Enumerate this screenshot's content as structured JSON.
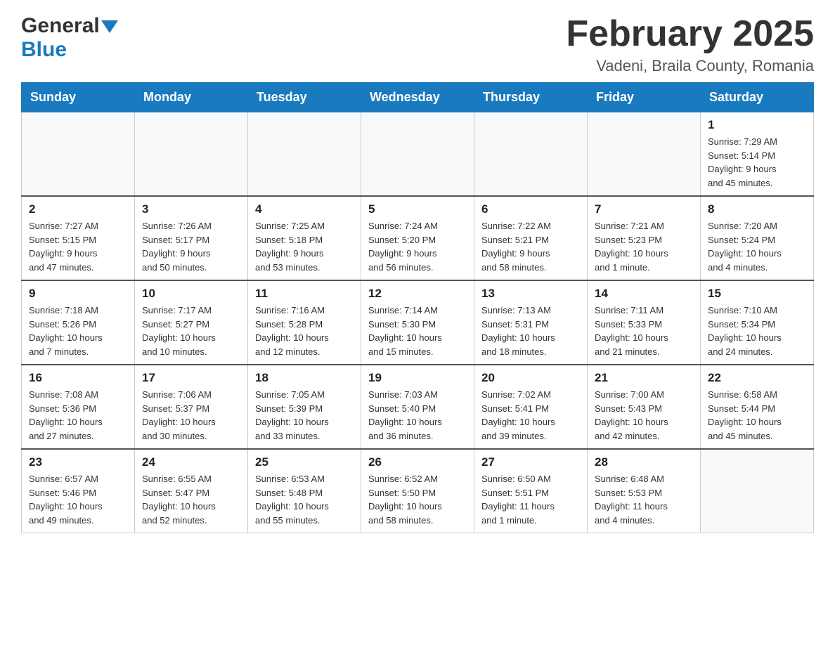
{
  "header": {
    "logo_general": "General",
    "logo_blue": "Blue",
    "month_title": "February 2025",
    "location": "Vadeni, Braila County, Romania"
  },
  "weekdays": [
    "Sunday",
    "Monday",
    "Tuesday",
    "Wednesday",
    "Thursday",
    "Friday",
    "Saturday"
  ],
  "weeks": [
    [
      {
        "day": "",
        "info": ""
      },
      {
        "day": "",
        "info": ""
      },
      {
        "day": "",
        "info": ""
      },
      {
        "day": "",
        "info": ""
      },
      {
        "day": "",
        "info": ""
      },
      {
        "day": "",
        "info": ""
      },
      {
        "day": "1",
        "info": "Sunrise: 7:29 AM\nSunset: 5:14 PM\nDaylight: 9 hours\nand 45 minutes."
      }
    ],
    [
      {
        "day": "2",
        "info": "Sunrise: 7:27 AM\nSunset: 5:15 PM\nDaylight: 9 hours\nand 47 minutes."
      },
      {
        "day": "3",
        "info": "Sunrise: 7:26 AM\nSunset: 5:17 PM\nDaylight: 9 hours\nand 50 minutes."
      },
      {
        "day": "4",
        "info": "Sunrise: 7:25 AM\nSunset: 5:18 PM\nDaylight: 9 hours\nand 53 minutes."
      },
      {
        "day": "5",
        "info": "Sunrise: 7:24 AM\nSunset: 5:20 PM\nDaylight: 9 hours\nand 56 minutes."
      },
      {
        "day": "6",
        "info": "Sunrise: 7:22 AM\nSunset: 5:21 PM\nDaylight: 9 hours\nand 58 minutes."
      },
      {
        "day": "7",
        "info": "Sunrise: 7:21 AM\nSunset: 5:23 PM\nDaylight: 10 hours\nand 1 minute."
      },
      {
        "day": "8",
        "info": "Sunrise: 7:20 AM\nSunset: 5:24 PM\nDaylight: 10 hours\nand 4 minutes."
      }
    ],
    [
      {
        "day": "9",
        "info": "Sunrise: 7:18 AM\nSunset: 5:26 PM\nDaylight: 10 hours\nand 7 minutes."
      },
      {
        "day": "10",
        "info": "Sunrise: 7:17 AM\nSunset: 5:27 PM\nDaylight: 10 hours\nand 10 minutes."
      },
      {
        "day": "11",
        "info": "Sunrise: 7:16 AM\nSunset: 5:28 PM\nDaylight: 10 hours\nand 12 minutes."
      },
      {
        "day": "12",
        "info": "Sunrise: 7:14 AM\nSunset: 5:30 PM\nDaylight: 10 hours\nand 15 minutes."
      },
      {
        "day": "13",
        "info": "Sunrise: 7:13 AM\nSunset: 5:31 PM\nDaylight: 10 hours\nand 18 minutes."
      },
      {
        "day": "14",
        "info": "Sunrise: 7:11 AM\nSunset: 5:33 PM\nDaylight: 10 hours\nand 21 minutes."
      },
      {
        "day": "15",
        "info": "Sunrise: 7:10 AM\nSunset: 5:34 PM\nDaylight: 10 hours\nand 24 minutes."
      }
    ],
    [
      {
        "day": "16",
        "info": "Sunrise: 7:08 AM\nSunset: 5:36 PM\nDaylight: 10 hours\nand 27 minutes."
      },
      {
        "day": "17",
        "info": "Sunrise: 7:06 AM\nSunset: 5:37 PM\nDaylight: 10 hours\nand 30 minutes."
      },
      {
        "day": "18",
        "info": "Sunrise: 7:05 AM\nSunset: 5:39 PM\nDaylight: 10 hours\nand 33 minutes."
      },
      {
        "day": "19",
        "info": "Sunrise: 7:03 AM\nSunset: 5:40 PM\nDaylight: 10 hours\nand 36 minutes."
      },
      {
        "day": "20",
        "info": "Sunrise: 7:02 AM\nSunset: 5:41 PM\nDaylight: 10 hours\nand 39 minutes."
      },
      {
        "day": "21",
        "info": "Sunrise: 7:00 AM\nSunset: 5:43 PM\nDaylight: 10 hours\nand 42 minutes."
      },
      {
        "day": "22",
        "info": "Sunrise: 6:58 AM\nSunset: 5:44 PM\nDaylight: 10 hours\nand 45 minutes."
      }
    ],
    [
      {
        "day": "23",
        "info": "Sunrise: 6:57 AM\nSunset: 5:46 PM\nDaylight: 10 hours\nand 49 minutes."
      },
      {
        "day": "24",
        "info": "Sunrise: 6:55 AM\nSunset: 5:47 PM\nDaylight: 10 hours\nand 52 minutes."
      },
      {
        "day": "25",
        "info": "Sunrise: 6:53 AM\nSunset: 5:48 PM\nDaylight: 10 hours\nand 55 minutes."
      },
      {
        "day": "26",
        "info": "Sunrise: 6:52 AM\nSunset: 5:50 PM\nDaylight: 10 hours\nand 58 minutes."
      },
      {
        "day": "27",
        "info": "Sunrise: 6:50 AM\nSunset: 5:51 PM\nDaylight: 11 hours\nand 1 minute."
      },
      {
        "day": "28",
        "info": "Sunrise: 6:48 AM\nSunset: 5:53 PM\nDaylight: 11 hours\nand 4 minutes."
      },
      {
        "day": "",
        "info": ""
      }
    ]
  ]
}
